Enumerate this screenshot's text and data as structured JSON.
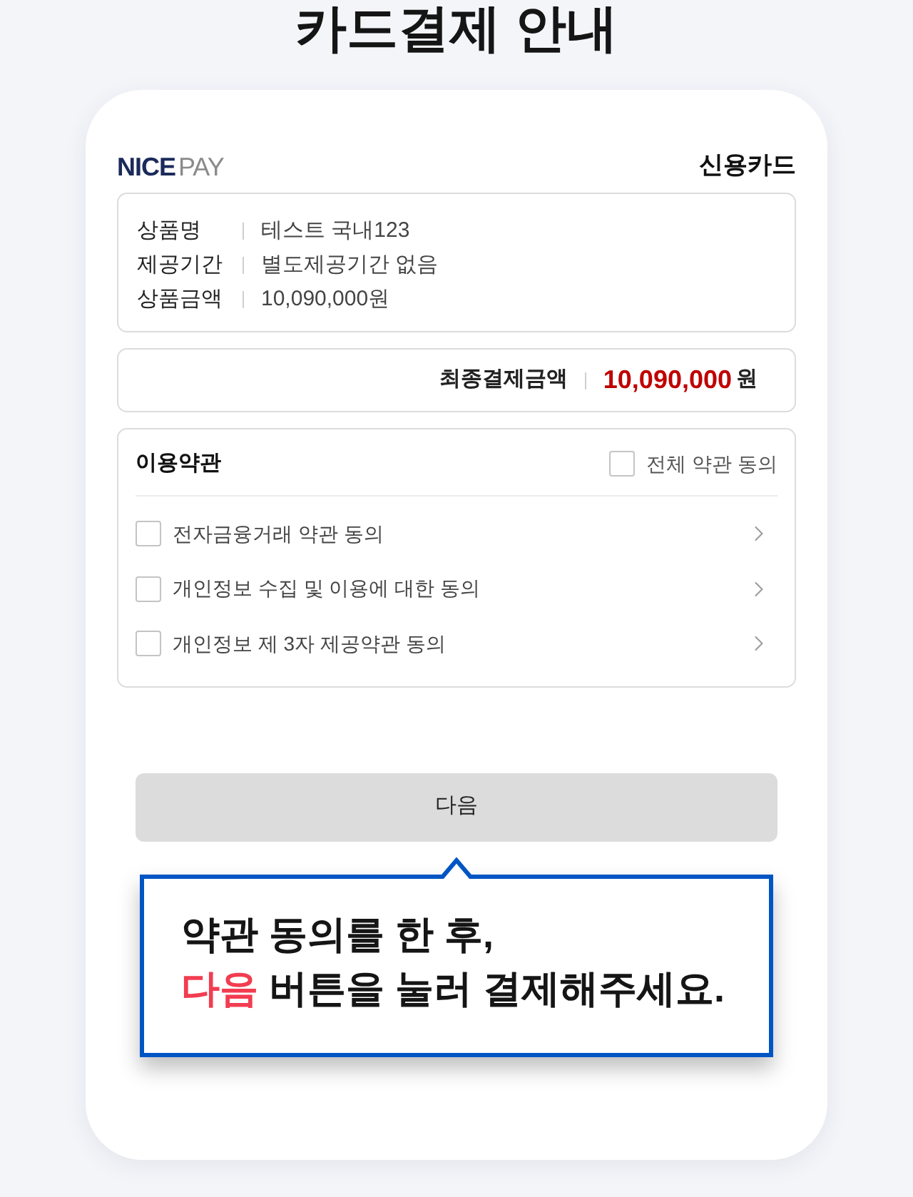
{
  "page_title": "카드결제 안내",
  "payment": {
    "logo": {
      "primary": "NICE",
      "secondary": "PAY"
    },
    "method": "신용카드"
  },
  "order_details": [
    {
      "label": "상품명",
      "value": "테스트 국내123"
    },
    {
      "label": "제공기간",
      "value": "별도제공기간 없음"
    },
    {
      "label": "상품금액",
      "value": "10,090,000원"
    }
  ],
  "total": {
    "label": "최종결제금액",
    "amount": "10,090,000",
    "unit": "원"
  },
  "terms": {
    "title": "이용약관",
    "agree_all": {
      "label": "전체 약관 동의",
      "checked": false
    },
    "items": [
      {
        "label": "전자금융거래 약관 동의",
        "checked": false
      },
      {
        "label": "개인정보 수집 및 이용에 대한 동의",
        "checked": false
      },
      {
        "label": "개인정보 제 3자 제공약관 동의",
        "checked": false
      }
    ]
  },
  "next_button": {
    "label": "다음",
    "disabled": true
  },
  "hint": {
    "lines": [
      "약관 동의를 한 후,",
      "**다음** 버튼을 눌러 결제해주세요."
    ]
  }
}
